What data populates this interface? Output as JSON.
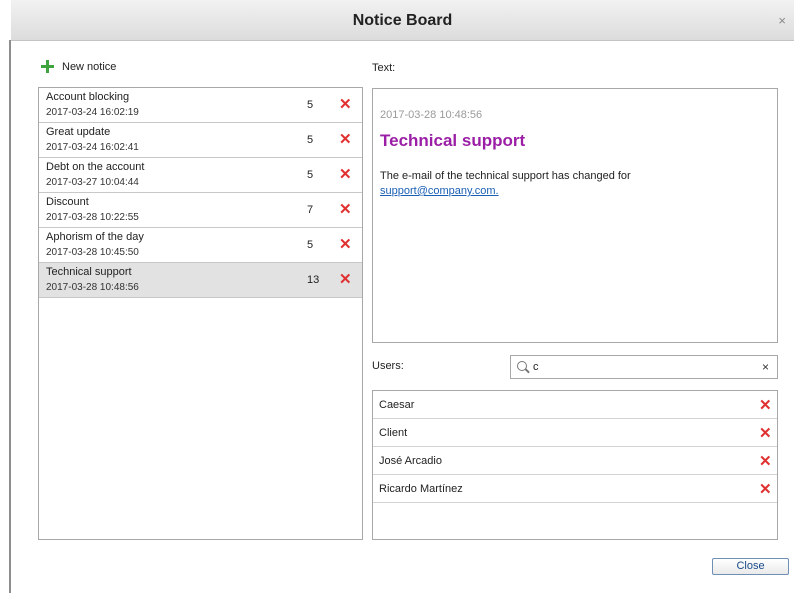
{
  "window": {
    "title": "Notice Board",
    "close_glyph": "×"
  },
  "toolbar": {
    "new_notice_label": "New notice"
  },
  "notices": [
    {
      "title": "Account blocking",
      "date": "2017-03-24 16:02:19",
      "count": "5",
      "selected": false
    },
    {
      "title": "Great update",
      "date": "2017-03-24 16:02:41",
      "count": "5",
      "selected": false
    },
    {
      "title": "Debt on the account",
      "date": "2017-03-27 10:04:44",
      "count": "5",
      "selected": false
    },
    {
      "title": "Discount",
      "date": "2017-03-28 10:22:55",
      "count": "7",
      "selected": false
    },
    {
      "title": "Aphorism of the day",
      "date": "2017-03-28 10:45:50",
      "count": "5",
      "selected": false
    },
    {
      "title": "Technical support",
      "date": "2017-03-28 10:48:56",
      "count": "13",
      "selected": true
    }
  ],
  "text_panel": {
    "label": "Text:",
    "date": "2017-03-28 10:48:56",
    "title": "Technical support",
    "body": "The e-mail of the technical support has changed for",
    "link": "support@company.com."
  },
  "users_panel": {
    "label": "Users:",
    "search_value": "c",
    "clear_glyph": "×",
    "users": [
      "Caesar",
      "Client",
      "José Arcadio",
      "Ricardo Martínez"
    ]
  },
  "footer": {
    "close_label": "Close"
  },
  "icons": {
    "delete_glyph": "✕",
    "add": "plus-icon",
    "search": "search-icon"
  },
  "colors": {
    "delete": "#e03030",
    "add": "#3fa43f",
    "title_accent": "#9b1fa6",
    "link": "#1a5fb4"
  }
}
